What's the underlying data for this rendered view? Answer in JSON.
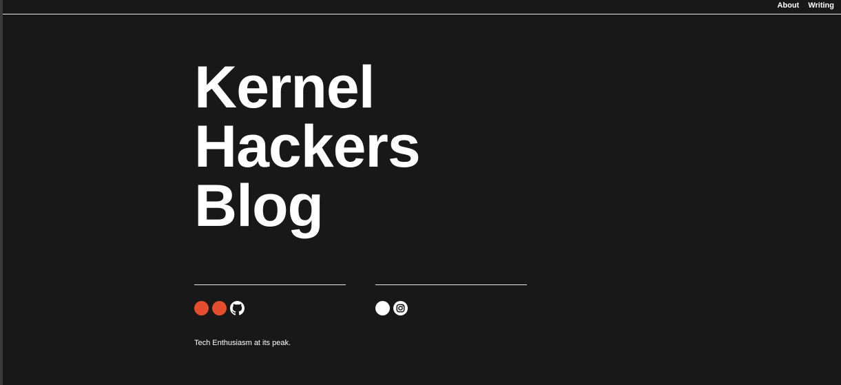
{
  "nav": {
    "about_label": "About",
    "writing_label": "Writing"
  },
  "hero": {
    "line1": "Kernel",
    "line2": "Hackers",
    "line3": "Blog"
  },
  "social_left": {
    "icons": [
      "circle-icon",
      "circle-icon",
      "github-icon"
    ],
    "accent_color": "#e44d2e"
  },
  "social_right": {
    "icons": [
      "circle-icon",
      "instagram-icon"
    ],
    "color": "#ffffff"
  },
  "tagline": "Tech Enthusiasm at its peak.",
  "colors": {
    "background": "#181818",
    "text": "#ffffff",
    "accent": "#e44d2e"
  }
}
